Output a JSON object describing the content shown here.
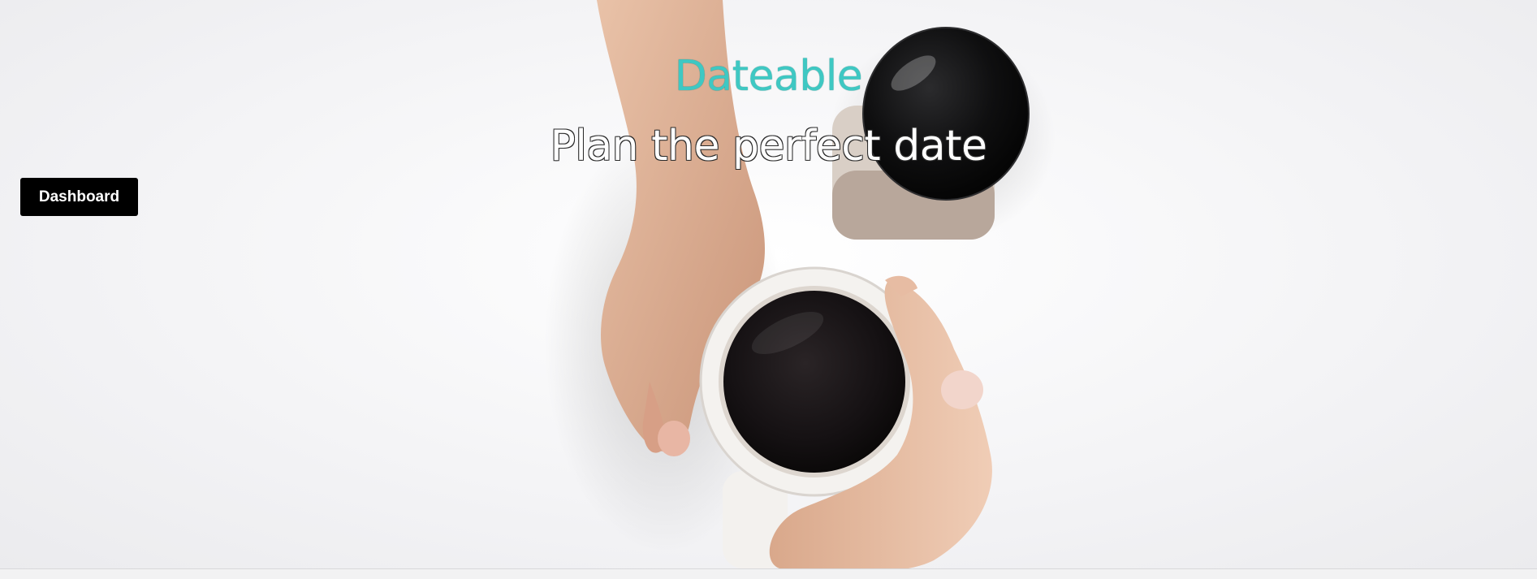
{
  "hero": {
    "title": "Dateable",
    "subtitle": "Plan the perfect date",
    "title_color": "#3ec8c3"
  },
  "nav": {
    "dashboard_label": "Dashboard"
  },
  "background_image": {
    "icons": [
      "coffee-cup-icon",
      "coffee-jar-icon"
    ]
  }
}
